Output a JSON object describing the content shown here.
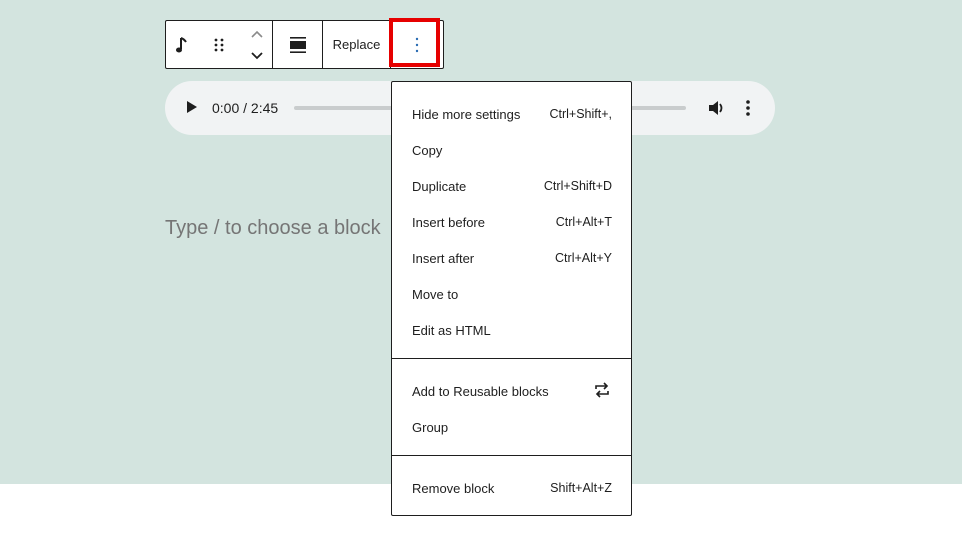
{
  "toolbar": {
    "replace_label": "Replace",
    "icons": [
      "music-note-icon",
      "drag-handle-icon",
      "chevron-up-icon",
      "chevron-down-icon",
      "align-icon",
      "more-vertical-icon"
    ],
    "highlight_color": "#e60000"
  },
  "audio": {
    "time": "0:00 / 2:45",
    "progress": 0
  },
  "editor": {
    "placeholder": "Type / to choose a block"
  },
  "menu": {
    "items": [
      {
        "label": "Hide more settings",
        "shortcut": "Ctrl+Shift+,"
      },
      {
        "label": "Copy",
        "shortcut": ""
      },
      {
        "label": "Duplicate",
        "shortcut": "Ctrl+Shift+D"
      },
      {
        "label": "Insert before",
        "shortcut": "Ctrl+Alt+T"
      },
      {
        "label": "Insert after",
        "shortcut": "Ctrl+Alt+Y"
      },
      {
        "label": "Move to",
        "shortcut": ""
      },
      {
        "label": "Edit as HTML",
        "shortcut": ""
      },
      {
        "label": "Add to Reusable blocks",
        "icon": "reusable-block-icon"
      },
      {
        "label": "Group",
        "shortcut": ""
      },
      {
        "label": "Remove block",
        "shortcut": "Shift+Alt+Z"
      }
    ]
  },
  "colors": {
    "canvas_background": "#d3e4df",
    "text": "#1e1e1e",
    "placeholder": "#757575"
  }
}
